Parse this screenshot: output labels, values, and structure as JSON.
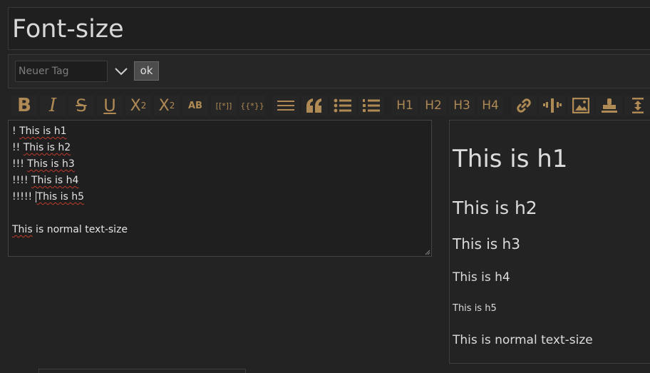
{
  "page": {
    "title": "Font-size"
  },
  "tags": {
    "placeholder": "Neuer Tag",
    "ok_label": "ok"
  },
  "toolbar": {
    "bold": "B",
    "italic": "I",
    "strike": "S",
    "underline": "U",
    "sup_base": "X",
    "sup_exp": "2",
    "sub_base": "X",
    "sub_exp": "2",
    "ab": "AB",
    "link_macro": "[[*]]",
    "transclude": "{{*}}",
    "h1": "H1",
    "h2": "H2",
    "h3": "H3",
    "h4": "H4",
    "icon_color": "#b08a54"
  },
  "editor": {
    "lines": [
      {
        "prefix": "! ",
        "text": "This is h1"
      },
      {
        "prefix": "!! ",
        "text": "This is h2"
      },
      {
        "prefix": "!!! ",
        "text": "This is h3"
      },
      {
        "prefix": "!!!! ",
        "text": "This is h4"
      },
      {
        "prefix": "!!!!! ",
        "text": "This is h5"
      }
    ],
    "normal_word": "This",
    "normal_rest": " is normal text-size"
  },
  "preview": {
    "h1": "This is h1",
    "h2": "This is h2",
    "h3": "This is h3",
    "h4": "This is h4",
    "h5": "This is h5",
    "normal": "This is normal text-size"
  }
}
